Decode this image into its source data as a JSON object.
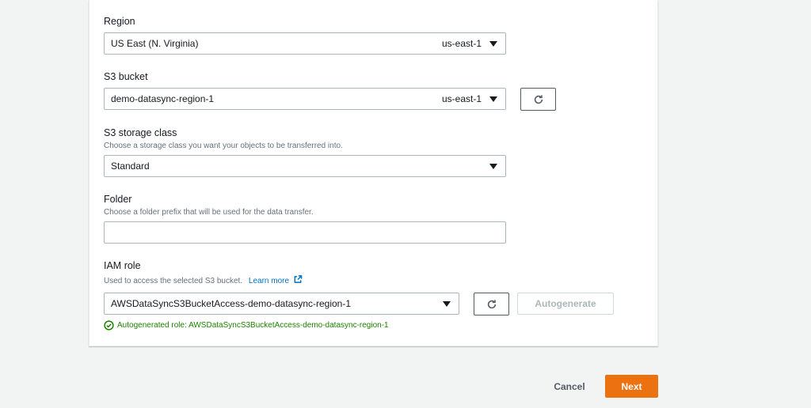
{
  "region": {
    "label": "Region",
    "selected": "US East (N. Virginia)",
    "code": "us-east-1"
  },
  "s3_bucket": {
    "label": "S3 bucket",
    "selected": "demo-datasync-region-1",
    "region_code": "us-east-1"
  },
  "storage_class": {
    "label": "S3 storage class",
    "description": "Choose a storage class you want your objects to be transferred into.",
    "selected": "Standard"
  },
  "folder": {
    "label": "Folder",
    "description": "Choose a folder prefix that will be used for the data transfer.",
    "value": "",
    "placeholder": ""
  },
  "iam_role": {
    "label": "IAM role",
    "description": "Used to access the selected S3 bucket.",
    "learn_more": "Learn more",
    "selected": "AWSDataSyncS3BucketAccess-demo-datasync-region-1",
    "autogenerate_label": "Autogenerate",
    "success_message": "Autogenerated role: AWSDataSyncS3BucketAccess-demo-datasync-region-1"
  },
  "footer": {
    "cancel_label": "Cancel",
    "next_label": "Next"
  },
  "colors": {
    "primary_button": "#ec7211",
    "link": "#0073bb",
    "success": "#1d8102"
  }
}
